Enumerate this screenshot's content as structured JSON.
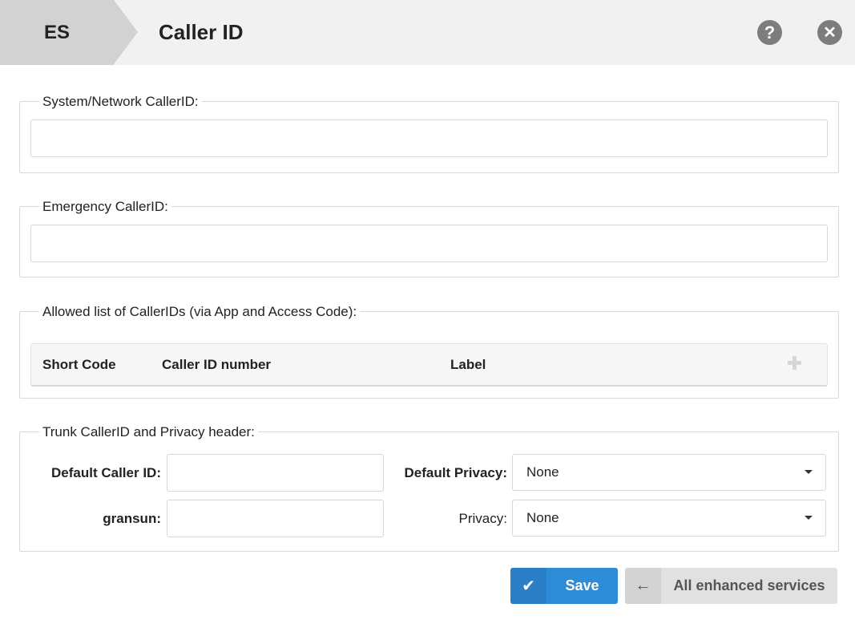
{
  "header": {
    "breadcrumb": "ES",
    "title": "Caller ID",
    "help_icon": "question-circle-icon",
    "close_icon": "close-circle-icon"
  },
  "system_network": {
    "legend": "System/Network CallerID:",
    "value": ""
  },
  "emergency": {
    "legend": "Emergency CallerID:",
    "value": ""
  },
  "allowed_list": {
    "legend": "Allowed list of CallerIDs (via App and Access Code):",
    "columns": [
      "Short Code",
      "Caller ID number",
      "Label"
    ],
    "add_icon": "plus-icon",
    "rows": []
  },
  "trunk": {
    "legend": "Trunk CallerID and Privacy header:",
    "default_caller_id_label": "Default Caller ID:",
    "default_caller_id_value": "",
    "gransun_label": "gransun:",
    "gransun_value": "",
    "default_privacy_label": "Default Privacy:",
    "default_privacy_value": "None",
    "privacy_label": "Privacy:",
    "privacy_value": "None"
  },
  "actions": {
    "save_label": "Save",
    "save_icon": "check-icon",
    "back_label": "All enhanced services",
    "back_icon": "arrow-left-icon"
  },
  "colors": {
    "primary": "#2e8bd6",
    "header_bg": "#f1f1f1",
    "breadcrumb_bg": "#d2d2d2"
  }
}
